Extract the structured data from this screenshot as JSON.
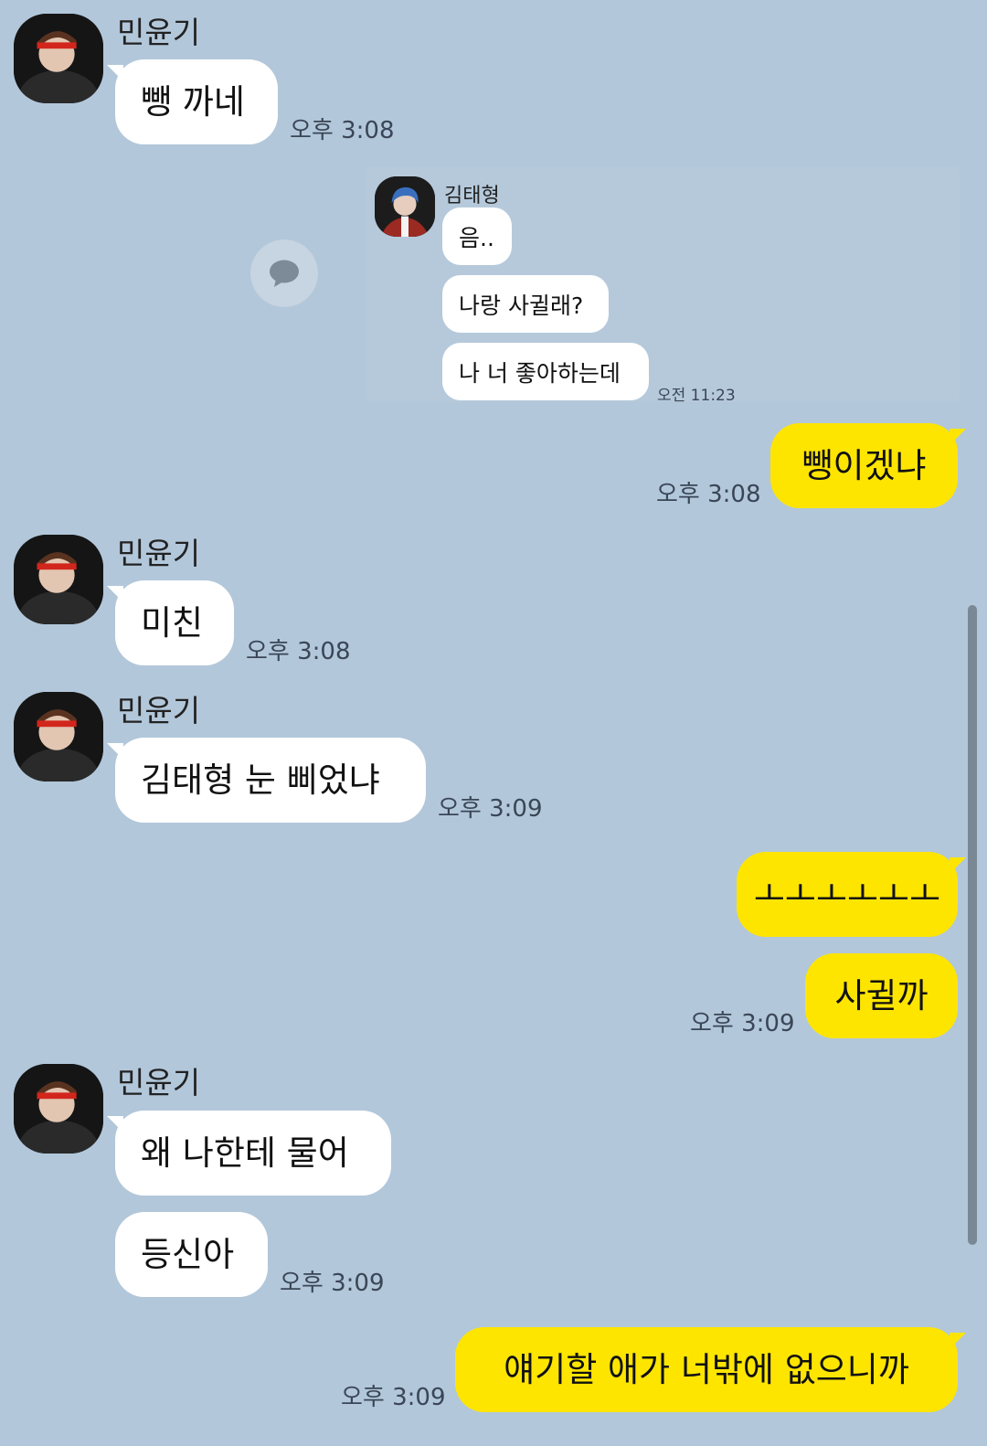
{
  "colors": {
    "background": "#b2c7da",
    "incoming_bubble": "#ffffff",
    "outgoing_bubble": "#fee500"
  },
  "messages": [
    {
      "sender": "민윤기",
      "text": "뺑 까네",
      "time": "오후 3:08"
    },
    {
      "shared_chat": {
        "sender": "김태형",
        "lines": [
          "음..",
          "나랑 사귈래?",
          "나 너 좋아하는데"
        ],
        "time": "오전 11:23",
        "share_icon": "speech-bubble-icon"
      }
    },
    {
      "sender": "me",
      "text": "뺑이겠냐",
      "time": "오후 3:08"
    },
    {
      "sender": "민윤기",
      "text": "미친",
      "time": "오후 3:08"
    },
    {
      "sender": "민윤기",
      "text": "김태형 눈 삐었냐",
      "time": "오후 3:09"
    },
    {
      "sender": "me",
      "text": "ㅗㅗㅗㅗㅗㅗ"
    },
    {
      "sender": "me",
      "text": "사귈까",
      "time": "오후 3:09"
    },
    {
      "sender": "민윤기",
      "text": "왜 나한테 물어"
    },
    {
      "sender": "민윤기",
      "text": "등신아",
      "time": "오후 3:09"
    },
    {
      "sender": "me",
      "text": "얘기할 애가 너밖에 없으니까",
      "time": "오후 3:09"
    }
  ]
}
